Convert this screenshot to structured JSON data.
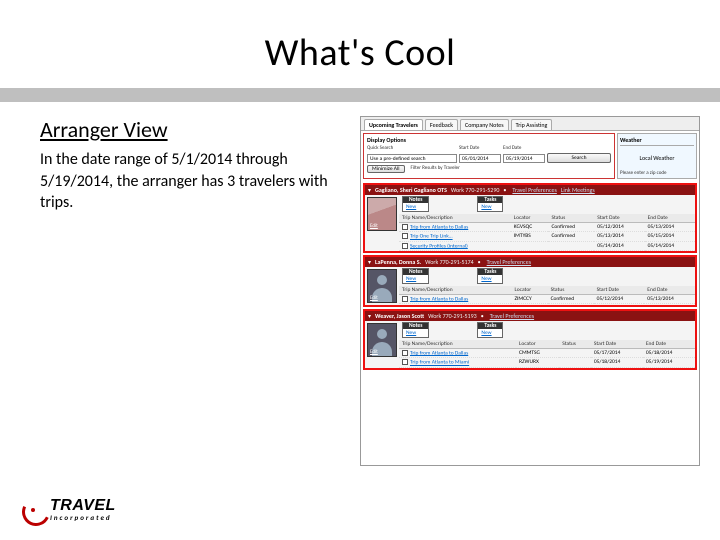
{
  "title": "What's Cool",
  "subtitle": "Arranger View",
  "description": "In the date range of 5/1/2014 through 5/19/2014, the arranger has 3 travelers with trips.",
  "logo": {
    "brand": "TRAVEL",
    "sub": "Incorporated"
  },
  "app": {
    "tabs": [
      "Upcoming Travelers",
      "Feedback",
      "Company Notes",
      "Trip Assisting"
    ],
    "display_options": {
      "title": "Display Options",
      "quick_label": "Quick Search",
      "quick_value": "Use a pre-defined search",
      "start_label": "Start Date",
      "start_value": "05/01/2014",
      "end_label": "End Date",
      "end_value": "05/19/2014",
      "search_btn": "Search",
      "row2_a": "Minimize All",
      "row2_b": "Filter Results by Traveler"
    },
    "weather": {
      "title": "Weather",
      "body": "Local Weather",
      "hint": "Please enter a zip code"
    },
    "columns": {
      "name": "Trip Name/Description",
      "locator": "Locator",
      "status": "Status",
      "start": "Start Date",
      "end": "End Date"
    },
    "notes_label": "Notes",
    "tasks_label": "Tasks",
    "new_label": "New",
    "edit_label": "Edit",
    "travelers": [
      {
        "name": "Gagliano, Sheri Gagliano OTS",
        "phone": "Work 770-291-5290",
        "links": [
          "Travel Preferences",
          "Link Meetings"
        ],
        "trips": [
          {
            "name": "Trip from Atlanta to Dallas",
            "locator": "KGVSQC",
            "status": "Confirmed",
            "start": "05/12/2014",
            "end": "05/13/2014"
          },
          {
            "name": "Trip One Trip Link…",
            "locator": "IMTYBS",
            "status": "Confirmed",
            "start": "05/13/2014",
            "end": "05/15/2014"
          },
          {
            "name": "Security Profiles (internal)",
            "locator": "",
            "status": "",
            "start": "05/14/2014",
            "end": "05/14/2014"
          }
        ]
      },
      {
        "name": "LaPenna, Donna S.",
        "phone": "Work 770-291-5174",
        "links": [
          "Travel Preferences"
        ],
        "trips": [
          {
            "name": "Trip from Atlanta to Dallas",
            "locator": "ZIMCCY",
            "status": "Confirmed",
            "start": "05/12/2014",
            "end": "05/13/2014"
          }
        ]
      },
      {
        "name": "Weaver, Jason Scott",
        "phone": "Work 770-291-5193",
        "links": [
          "Travel Preferences"
        ],
        "trips": [
          {
            "name": "Trip from Atlanta to Dallas",
            "locator": "CMMTSG",
            "status": "",
            "start": "05/17/2014",
            "end": "05/18/2014"
          },
          {
            "name": "Trip from Atlanta to Miami",
            "locator": "RZWURX",
            "status": "",
            "start": "05/18/2014",
            "end": "05/19/2014"
          }
        ]
      }
    ]
  }
}
